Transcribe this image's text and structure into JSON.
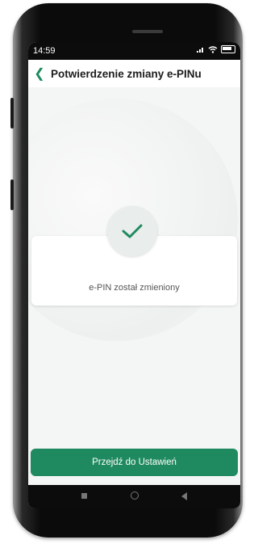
{
  "status_bar": {
    "time": "14:59",
    "signal": "signal-icon",
    "wifi": "wifi-icon",
    "battery": "battery-icon"
  },
  "header": {
    "title": "Potwierdzenie zmiany e-PINu",
    "back_icon": "chevron-left-icon"
  },
  "confirmation": {
    "icon": "checkmark-icon",
    "message": "e-PIN został zmieniony"
  },
  "actions": {
    "primary_label": "Przejdź do Ustawień"
  },
  "nav_bar": {
    "items": [
      "square-icon",
      "circle-icon",
      "triangle-back-icon"
    ]
  },
  "colors": {
    "accent": "#1f8a5f",
    "background": "#f4f5f5"
  }
}
